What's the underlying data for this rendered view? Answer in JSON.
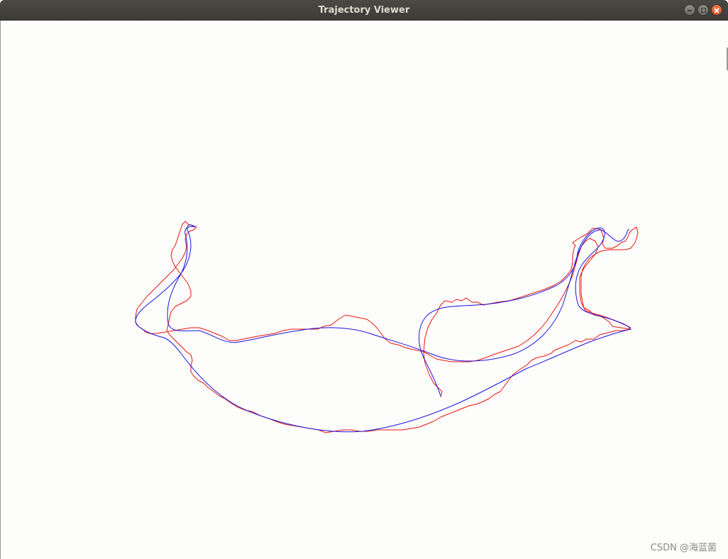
{
  "window": {
    "title": "Trajectory Viewer"
  },
  "controls": {
    "minimize_icon": "minimize-icon",
    "maximize_icon": "maximize-icon",
    "close_icon": "close-icon"
  },
  "trajectories": [
    {
      "name_hidden": true,
      "color": "#e8140c"
    },
    {
      "name_hidden": true,
      "color": "#1a14e0"
    }
  ],
  "watermark": "CSDN @海蓝菌"
}
